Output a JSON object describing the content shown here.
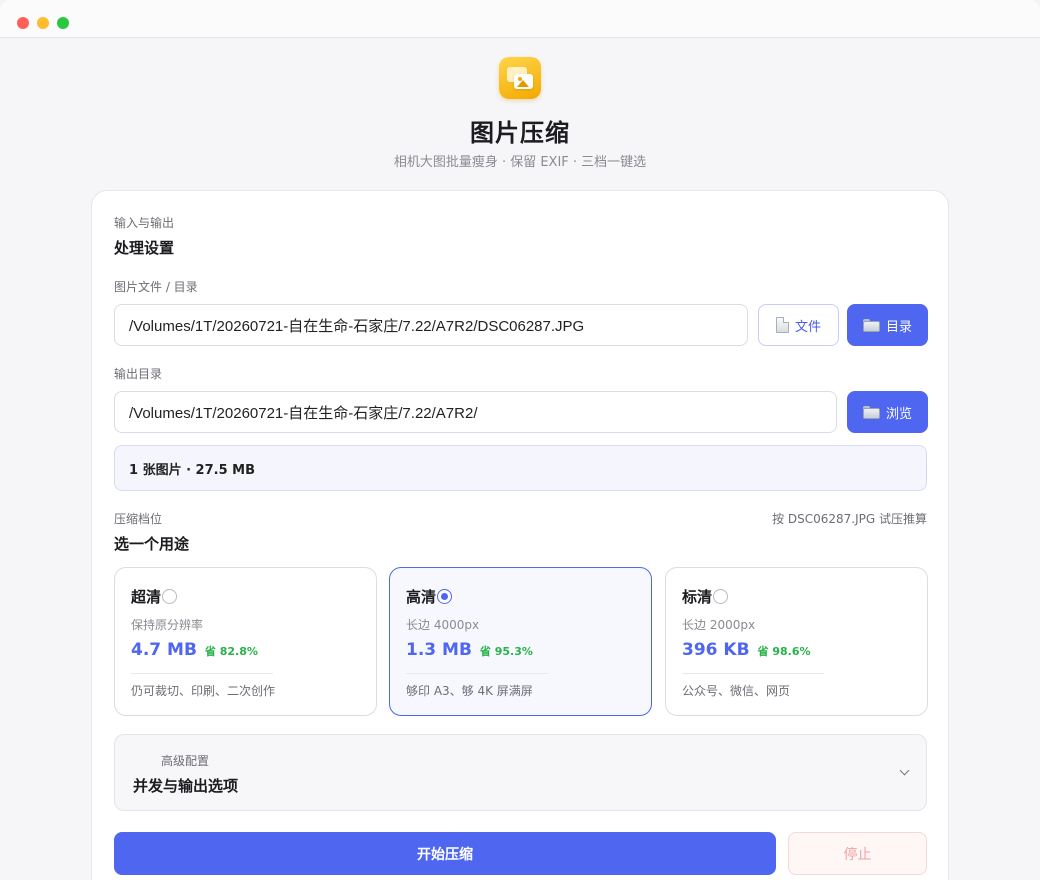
{
  "window": {
    "traffic_lights": {
      "close": "#ff5f57",
      "minimize": "#febc2e",
      "maximize": "#28c840"
    }
  },
  "header": {
    "app_icon": "photos-app-icon",
    "title": "图片压缩",
    "subtitle": "相机大图批量瘦身 · 保留 EXIF · 三档一键选"
  },
  "io": {
    "caption": "输入与输出",
    "title": "处理设置",
    "input_label": "图片文件 / 目录",
    "input_value": "/Volumes/1T/20260721-自在生命-石家庄/7.22/A7R2/DSC06287.JPG",
    "file_button": "文件",
    "dir_button": "目录",
    "output_label": "输出目录",
    "output_value": "/Volumes/1T/20260721-自在生命-石家庄/7.22/A7R2/",
    "browse_button": "浏览",
    "summary": "1 张图片 · 27.5 MB"
  },
  "compression": {
    "caption": "压缩档位",
    "hint": "按 DSC06287.JPG 试压推算",
    "title": "选一个用途",
    "tiers": [
      {
        "name": "超清",
        "desc": "保持原分辨率",
        "size": "4.7 MB",
        "save": "省 82.8%",
        "use": "仍可裁切、印刷、二次创作",
        "selected": false
      },
      {
        "name": "高清",
        "desc": "长边 4000px",
        "size": "1.3 MB",
        "save": "省 95.3%",
        "use": "够印 A3、够 4K 屏满屏",
        "selected": true
      },
      {
        "name": "标清",
        "desc": "长边 2000px",
        "size": "396 KB",
        "save": "省 98.6%",
        "use": "公众号、微信、网页",
        "selected": false
      }
    ]
  },
  "advanced": {
    "caption": "高级配置",
    "title": "并发与输出选项"
  },
  "actions": {
    "start": "开始压缩",
    "stop": "停止"
  },
  "colors": {
    "accent": "#4e66f0",
    "save_green": "#27b24a",
    "stop_text": "#f0a3a3"
  }
}
